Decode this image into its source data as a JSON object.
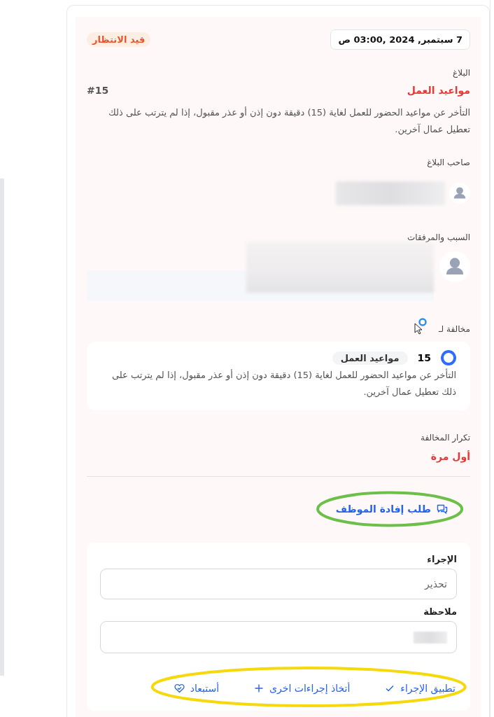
{
  "header": {
    "date": "7 سبتمبر, 2024 ,03:00 ص",
    "status": "قيد الانتظار"
  },
  "report": {
    "label": "البلاغ",
    "title": "مواعيد العمل",
    "number": "#15",
    "description": "التأخر عن مواعيد الحضور للعمل لغاية (15) دقيقة دون إذن أو عذر مقبول، إذا لم يترتب على ذلك تعطيل عمال آخرين."
  },
  "owner": {
    "label": "صاحب البلاغ"
  },
  "reason": {
    "label": "السبب والمرفقات"
  },
  "violation": {
    "label": "مخالفة لـ",
    "options": [
      {
        "number": "15",
        "category": "مواعيد العمل",
        "description": "التأخر عن مواعيد الحضور للعمل لغاية (15) دقيقة دون إذن أو عذر مقبول، إذا لم يترتب على ذلك تعطيل عمال آخرين.",
        "selected": true
      }
    ]
  },
  "repetition": {
    "label": "تكرار المخالفة",
    "value": "أول مرة"
  },
  "request_link": {
    "label": "طلب إفادة الموظف",
    "highlight": {
      "color": "#6cc04a"
    }
  },
  "action_form": {
    "fields": [
      {
        "label": "الإجراء",
        "value": "تحذير"
      },
      {
        "label": "ملاحظة"
      }
    ],
    "buttons": [
      {
        "kind": "check",
        "label": "تطبيق الإجراء"
      },
      {
        "kind": "plus",
        "label": "أتخاذ إجراءات اخرى"
      },
      {
        "kind": "heart",
        "label": "أستبعاد"
      }
    ],
    "highlight": {
      "color": "#f5d90a"
    }
  }
}
